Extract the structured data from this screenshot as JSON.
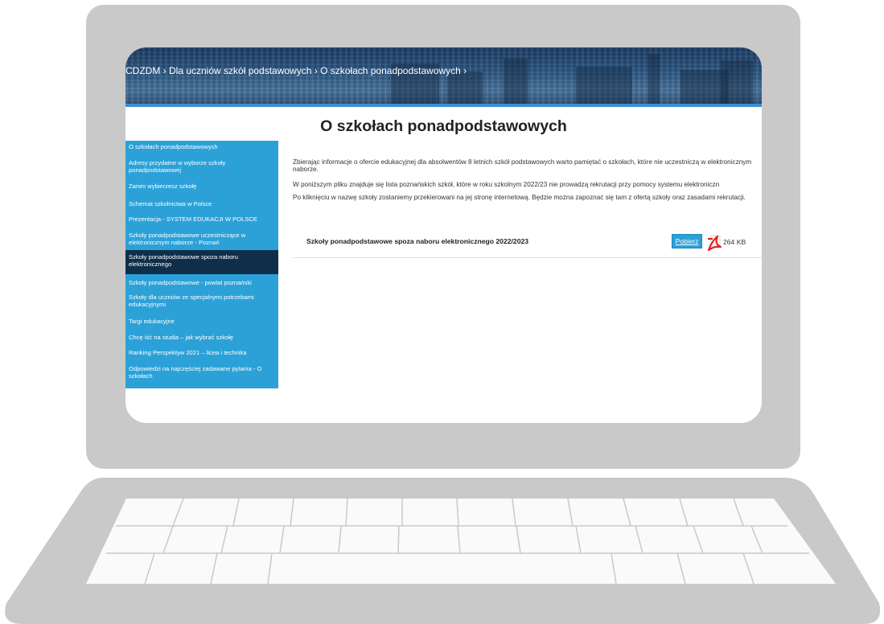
{
  "header": {
    "breadcrumb": "CDZDM › Dla uczniów szkół podstawowych › O szkołach ponadpodstawowych ›"
  },
  "page": {
    "title": "O szkołach ponadpodstawowych"
  },
  "sidebar": {
    "items": [
      {
        "label": "O szkołach ponadpodstawowych",
        "active": false
      },
      {
        "label": "Adresy przydatne w wyborze szkoły ponadpodstawowej",
        "active": false
      },
      {
        "label": "Zanim wybierzesz szkołę",
        "active": false
      },
      {
        "label": "Schemat szkolnictwa w Polsce",
        "active": false
      },
      {
        "label": "Prezentacja - SYSTEM EDUKACJI W POLSCE",
        "active": false
      },
      {
        "label": "Szkoły ponadpodstawowe uczestniczące w elektronicznym naborze - Poznań",
        "active": false
      },
      {
        "label": "Szkoły ponadpodstawowe spoza naboru elektronicznego",
        "active": true
      },
      {
        "label": "Szkoły ponadpodstawowe - powiat poznański",
        "active": false
      },
      {
        "label": "Szkoły dla uczniów ze specjalnymi potrzebami edukacyjnymi",
        "active": false
      },
      {
        "label": "Targi edukacyjne",
        "active": false
      },
      {
        "label": "Chcę iść na studia – jak wybrać szkołę",
        "active": false
      },
      {
        "label": "Ranking Perspektyw 2021 – licea i technika",
        "active": false
      },
      {
        "label": "Odpowiedzi na najczęściej zadawane pytania - O szkołach",
        "active": false
      }
    ]
  },
  "content": {
    "paragraphs": [
      "Zbierając informacje o ofercie edukacyjnej dla absolwentów 8 letnich szkół podstawowych warto pamiętać o szkołach, które nie uczestniczą w elektronicznym naborze.",
      "W poniższym pliku znajduje się lista poznańskich szkół, które w roku szkolnym 2022/23 nie prowadzą rekrutacji przy pomocy systemu elektroniczn",
      "Po kliknięciu w nazwę szkoły zostaniemy przekierowani na jej stronę internetową. Będzie można zapoznać się tam z ofertą szkoły oraz zasadami rekrutacji."
    ],
    "file": {
      "title": "Szkoły ponadpodstawowe spoza naboru elektronicznego 2022/2023",
      "download_label": "Pobierz",
      "size": "264 KB",
      "icon": "pdf-icon"
    }
  },
  "colors": {
    "sidebar_bg": "#2ba1d8",
    "sidebar_active_bg": "#0f2e4a",
    "banner_line": "#3d8fd0",
    "laptop_body": "#c9c9c9"
  }
}
